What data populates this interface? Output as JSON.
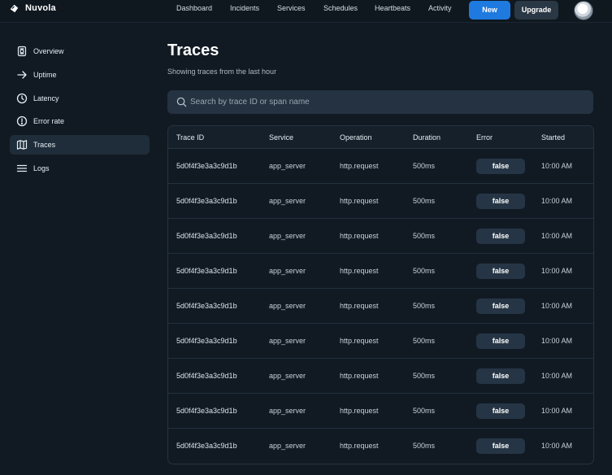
{
  "brand": {
    "name": "Nuvola"
  },
  "nav": {
    "links": [
      "Dashboard",
      "Incidents",
      "Services",
      "Schedules",
      "Heartbeats",
      "Activity"
    ],
    "new_label": "New",
    "upgrade_label": "Upgrade"
  },
  "sidebar": {
    "items": [
      {
        "label": "Overview",
        "icon": "overview-icon",
        "active": false
      },
      {
        "label": "Uptime",
        "icon": "arrow-right-icon",
        "active": false
      },
      {
        "label": "Latency",
        "icon": "clock-icon",
        "active": false
      },
      {
        "label": "Error rate",
        "icon": "alert-circle-icon",
        "active": false
      },
      {
        "label": "Traces",
        "icon": "map-icon",
        "active": true
      },
      {
        "label": "Logs",
        "icon": "menu-icon",
        "active": false
      }
    ]
  },
  "main": {
    "title": "Traces",
    "subtitle": "Showing traces from the last hour",
    "search": {
      "placeholder": "Search by trace ID or span name",
      "value": ""
    },
    "table": {
      "columns": [
        "Trace ID",
        "Service",
        "Operation",
        "Duration",
        "Error",
        "Started"
      ],
      "rows": [
        [
          "5d0f4f3e3a3c9d1b",
          "app_server",
          "http.request",
          "500ms",
          "false",
          "10:00 AM"
        ],
        [
          "5d0f4f3e3a3c9d1b",
          "app_server",
          "http.request",
          "500ms",
          "false",
          "10:00 AM"
        ],
        [
          "5d0f4f3e3a3c9d1b",
          "app_server",
          "http.request",
          "500ms",
          "false",
          "10:00 AM"
        ],
        [
          "5d0f4f3e3a3c9d1b",
          "app_server",
          "http.request",
          "500ms",
          "false",
          "10:00 AM"
        ],
        [
          "5d0f4f3e3a3c9d1b",
          "app_server",
          "http.request",
          "500ms",
          "false",
          "10:00 AM"
        ],
        [
          "5d0f4f3e3a3c9d1b",
          "app_server",
          "http.request",
          "500ms",
          "false",
          "10:00 AM"
        ],
        [
          "5d0f4f3e3a3c9d1b",
          "app_server",
          "http.request",
          "500ms",
          "false",
          "10:00 AM"
        ],
        [
          "5d0f4f3e3a3c9d1b",
          "app_server",
          "http.request",
          "500ms",
          "false",
          "10:00 AM"
        ],
        [
          "5d0f4f3e3a3c9d1b",
          "app_server",
          "http.request",
          "500ms",
          "false",
          "10:00 AM"
        ]
      ]
    }
  },
  "colors": {
    "background": "#111a23",
    "accent": "#1f7ae0",
    "active_item": "#1f2d3a"
  }
}
